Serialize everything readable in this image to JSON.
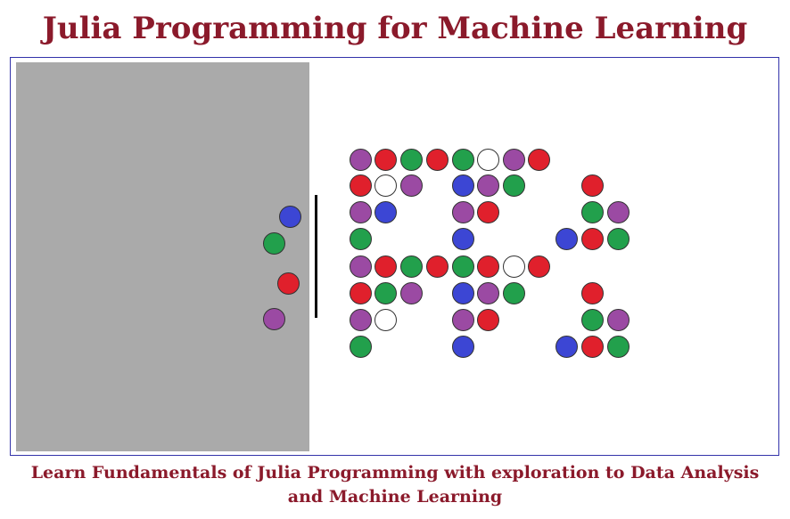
{
  "title": "Julia Programming for Machine Learning",
  "subtitle_line1": "Learn Fundamentals of Julia Programming with exploration to Data Analysis",
  "subtitle_line2": "and Machine Learning",
  "colors": {
    "title": "#8b1a2b",
    "panel": "#aaaaaa",
    "frame_border": "#3333aa",
    "purple": "#9b4aa3",
    "red": "#e0202c",
    "green": "#22a04c",
    "blue": "#3c46d4",
    "white": "#ffffff"
  },
  "left_dots": [
    "blue",
    "green",
    "red",
    "purple"
  ],
  "grid_rows": [
    [
      "purple",
      "red",
      "green",
      "red",
      "green",
      "white",
      "purple",
      "red"
    ],
    [
      "red",
      "white",
      "purple",
      "blue",
      "purple",
      "green",
      "red"
    ],
    [
      "purple",
      "blue",
      "purple",
      "red",
      "green",
      "purple"
    ],
    [
      "green",
      "blue",
      "blue",
      "red",
      "green"
    ],
    [
      "purple",
      "red",
      "green",
      "red",
      "green",
      "red",
      "white",
      "red"
    ],
    [
      "red",
      "green",
      "purple",
      "blue",
      "purple",
      "green",
      "red"
    ],
    [
      "purple",
      "white",
      "purple",
      "red",
      "green",
      "purple"
    ],
    [
      "green",
      "blue",
      "blue",
      "red",
      "green"
    ]
  ]
}
